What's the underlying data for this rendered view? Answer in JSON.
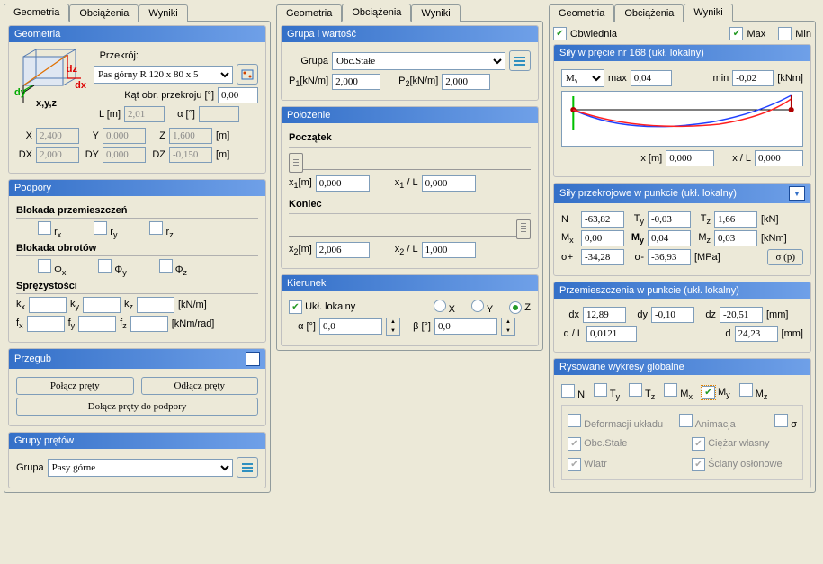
{
  "tabs": {
    "geom": "Geometria",
    "obc": "Obciążenia",
    "wyn": "Wyniki"
  },
  "col1": {
    "geom_head": "Geometria",
    "przekroj_lbl": "Przekrój:",
    "przekroj_val": "Pas górny R 120 x 80 x 5",
    "kat_lbl": "Kąt obr. przekroju [°]",
    "kat_val": "0,00",
    "L_lbl": "L [m]",
    "L_val": "2,01",
    "a_lbl": "α [°]",
    "a_val": "",
    "X_lbl": "X",
    "X_val": "2,400",
    "Y_lbl": "Y",
    "Y_val": "0,000",
    "Z_lbl": "Z",
    "Z_val": "1,600",
    "unit_m": "[m]",
    "DX_lbl": "DX",
    "DX_val": "2,000",
    "DY_lbl": "DY",
    "DY_val": "0,000",
    "DZ_lbl": "DZ",
    "DZ_val": "-0,150",
    "podpory_head": "Podpory",
    "blokada_przem": "Blokada przemieszczeń",
    "rx": "r",
    "ry": "r",
    "rz": "r",
    "blokada_obr": "Blokada obrotów",
    "fx": "Φ",
    "fy": "Φ",
    "fz": "Φ",
    "sprez": "Sprężystości",
    "kx": "k",
    "ky": "k",
    "kz": "k",
    "unit_knm": "[kN/m]",
    "ffx": "f",
    "ffy": "f",
    "ffz": "f",
    "unit_knmrad": "[kNm/rad]",
    "przegub_head": "Przegub",
    "polacz": "Połącz pręty",
    "odlacz": "Odłącz pręty",
    "dolacz": "Dołącz pręty do podpory",
    "grupy_head": "Grupy prętów",
    "grupa_lbl": "Grupa",
    "grupa_val": "Pasy górne",
    "cube": {
      "dx_lbl": "dx",
      "dy_lbl": "dy",
      "dz_lbl": "dz",
      "xyz_lbl": "x,y,z"
    }
  },
  "col2": {
    "gwhead": "Grupa i wartość",
    "grupa_lbl": "Grupa",
    "grupa_val": "Obc.Stałe",
    "p1_lbl": "P",
    "p1_unit": "[kN/m]",
    "p1_val": "2,000",
    "p2_lbl": "P",
    "p2_unit": "[kN/m]",
    "p2_val": "2,000",
    "pol_head": "Położenie",
    "poczatek": "Początek",
    "x1_lbl": "x",
    "x1_unit": "[m]",
    "x1_val": "0,000",
    "x1L_lbl": "x",
    "x1L_unit": " / L",
    "x1L_val": "0,000",
    "koniec": "Koniec",
    "x2_lbl": "x",
    "x2_unit": "[m]",
    "x2_val": "2,006",
    "x2L_lbl": "x",
    "x2L_unit": " / L",
    "x2L_val": "1,000",
    "kier_head": "Kierunek",
    "ukl_lok": "Ukł. lokalny",
    "opt_x": "X",
    "opt_y": "Y",
    "opt_z": "Z",
    "alpha_lbl": "α [°]",
    "alpha_val": "0,0",
    "beta_lbl": "β [°]",
    "beta_val": "0,0"
  },
  "col3": {
    "obwiednia": "Obwiednia",
    "max": "Max",
    "min": "Min",
    "sily_head": "Siły w pręcie nr 168 (ukł. lokalny)",
    "my_sel": "M",
    "max_lbl": "max",
    "max_val": "0,04",
    "min_lbl": "min",
    "min_val": "-0,02",
    "unit_knm": "[kNm]",
    "xm_lbl": "x [m]",
    "xm_val": "0,000",
    "xL_lbl": "x / L",
    "xL_val": "0,000",
    "sp_head": "Siły przekrojowe w punkcie (ukł. lokalny)",
    "N_lbl": "N",
    "N_val": "-63,82",
    "Ty_lbl": "T",
    "Ty_val": "-0,03",
    "Tz_lbl": "T",
    "Tz_val": "1,66",
    "unit_kn": "[kN]",
    "Mx_lbl": "M",
    "Mx_val": "0,00",
    "My_lbl": "M",
    "My_val": "0,04",
    "Mz_lbl": "M",
    "Mz_val": "0,03",
    "sp_lbl": "σ+",
    "sp_val": "-34,28",
    "sm_lbl": "σ-",
    "sm_val": "-36,93",
    "unit_mpa": "[MPa]",
    "sigma_p_btn": "σ (p)",
    "przem_head": "Przemieszczenia w punkcie (ukł. lokalny)",
    "dx_lbl": "dx",
    "dx_val": "12,89",
    "dy_lbl": "dy",
    "dy_val": "-0,10",
    "dz_lbl": "dz",
    "dz_val": "-20,51",
    "unit_mm": "[mm]",
    "dL_lbl": "d / L",
    "dL_val": "0,0121",
    "d_lbl": "d",
    "d_val": "24,23",
    "ryso_head": "Rysowane wykresy globalne",
    "ck_N": "N",
    "ck_Ty": "T",
    "ck_Tz": "T",
    "ck_Mx": "M",
    "ck_My": "M",
    "ck_Mz": "M",
    "ck_def": "Deformacji układu",
    "ck_anim": "Animacja",
    "ck_sigma": "σ",
    "ck_obc": "Obc.Stałe",
    "ck_ciezar": "Ciężar własny",
    "ck_wiatr": "Wiatr",
    "ck_sciany": "Ściany osłonowe"
  },
  "chart_data": {
    "type": "line",
    "title": "Siły w pręcie nr 168 — M_y",
    "xlabel": "x / L",
    "ylabel": "M_y [kNm]",
    "x": [
      0.0,
      0.1,
      0.2,
      0.3,
      0.4,
      0.5,
      0.6,
      0.7,
      0.8,
      0.9,
      1.0
    ],
    "series": [
      {
        "name": "max",
        "color": "#2040ff",
        "values": [
          0.0,
          -0.012,
          -0.018,
          -0.02,
          -0.018,
          -0.012,
          0.0,
          0.012,
          0.025,
          0.035,
          0.04
        ]
      },
      {
        "name": "min",
        "color": "#ff2020",
        "values": [
          0.0,
          -0.008,
          -0.014,
          -0.018,
          -0.02,
          -0.02,
          -0.016,
          -0.01,
          -0.002,
          0.01,
          0.035
        ]
      }
    ],
    "ylim": [
      -0.02,
      0.04
    ]
  }
}
